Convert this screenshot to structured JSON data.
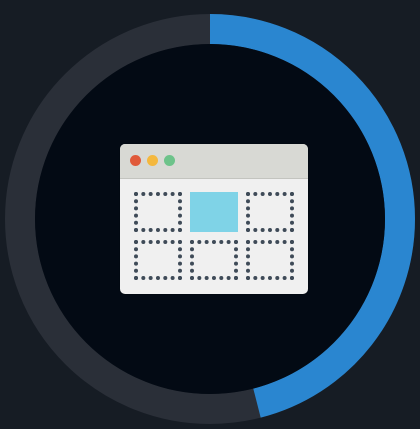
{
  "progress_ring": {
    "progress": 0.46,
    "track_color": "#2a2f38",
    "fill_color": "#2a86d0",
    "center_color": "#030a14"
  },
  "window_icon": {
    "traffic_lights": [
      {
        "name": "close",
        "color": "#e05a3a"
      },
      {
        "name": "minimize",
        "color": "#f4b83e"
      },
      {
        "name": "maximize",
        "color": "#6dc38a"
      }
    ],
    "selected_cell_color": "#7fd3e7",
    "frame_color": "#f0f0f0",
    "titlebar_color": "#d8d9d4"
  }
}
